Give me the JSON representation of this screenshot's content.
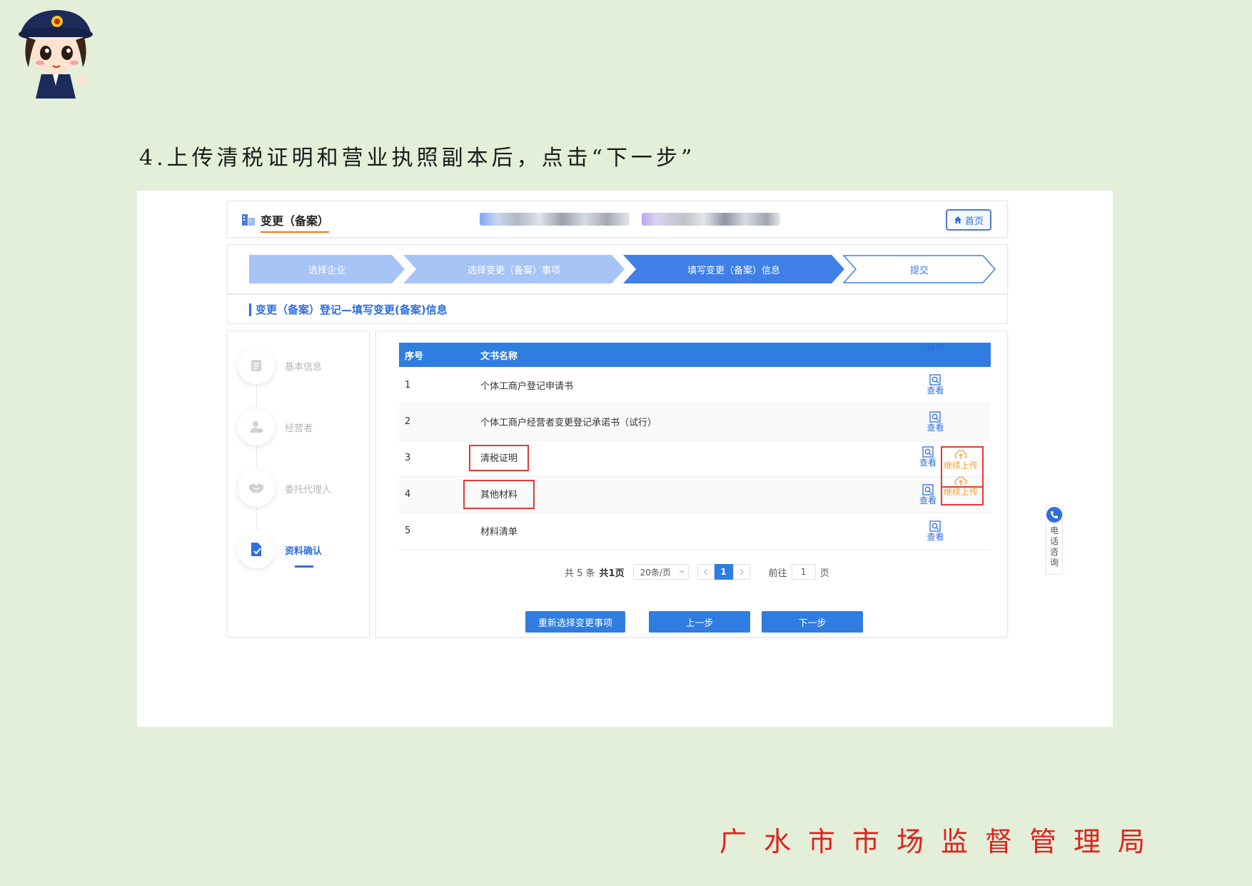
{
  "instruction": "4.上传清税证明和营业执照副本后，点击“下一步”",
  "footer_org": "广水市市场监督管理局",
  "app": {
    "title": "变更（备案）",
    "home_label": "首页"
  },
  "steps": [
    {
      "label": "选择企业"
    },
    {
      "label": "选择变更（备案）事项"
    },
    {
      "label": "填写变更（备案）信息"
    },
    {
      "label": "提交"
    }
  ],
  "section_title": "变更（备案）登记—填写变更(备案)信息",
  "sidebar": {
    "items": [
      {
        "label": "基本信息"
      },
      {
        "label": "经营者"
      },
      {
        "label": "委托代理人"
      },
      {
        "label": "资料确认"
      }
    ]
  },
  "table": {
    "headers": {
      "index": "序号",
      "name": "文书名称",
      "ops": "操作"
    },
    "rows": [
      {
        "index": "1",
        "name": "个体工商户登记申请书",
        "view": "查看"
      },
      {
        "index": "2",
        "name": "个体工商户经营者变更登记承诺书（试行）",
        "view": "查看"
      },
      {
        "index": "3",
        "name": "清税证明",
        "view": "查看",
        "upload": "继续上传"
      },
      {
        "index": "4",
        "name": "其他材料",
        "view": "查看",
        "upload": "继续上传"
      },
      {
        "index": "5",
        "name": "材料清单",
        "view": "查看"
      }
    ]
  },
  "pager": {
    "total": "共 5 条",
    "pages": "共1页",
    "page_size": "20条/页",
    "current": "1",
    "goto_prefix": "前往",
    "goto_value": "1",
    "goto_suffix": "页"
  },
  "buttons": {
    "reselect": "重新选择变更事项",
    "prev": "上一步",
    "next": "下一步"
  },
  "consult": {
    "label": "电话咨询"
  },
  "colors": {
    "background": "#e3efd9",
    "primary": "#2f7de1",
    "highlight_box": "#e53935",
    "footer_text": "#e2201c"
  }
}
